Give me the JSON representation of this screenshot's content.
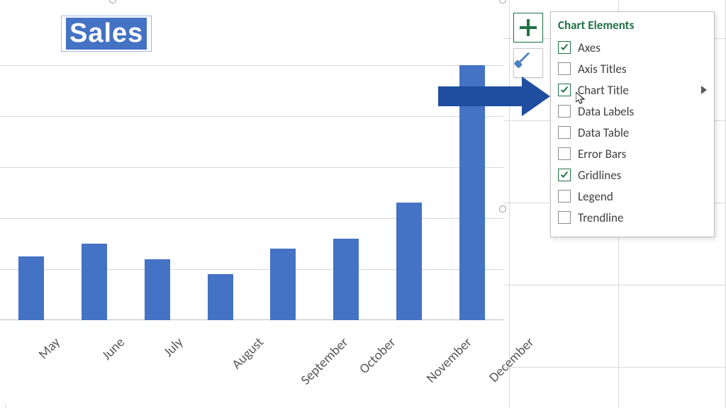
{
  "chart_title": "Sales",
  "flyout": {
    "title": "Chart Elements",
    "items": [
      {
        "label": "Axes",
        "checked": true,
        "submenu": false
      },
      {
        "label": "Axis Titles",
        "checked": false,
        "submenu": false
      },
      {
        "label": "Chart Title",
        "checked": true,
        "submenu": true
      },
      {
        "label": "Data Labels",
        "checked": false,
        "submenu": false
      },
      {
        "label": "Data Table",
        "checked": false,
        "submenu": false
      },
      {
        "label": "Error Bars",
        "checked": false,
        "submenu": false
      },
      {
        "label": "Gridlines",
        "checked": true,
        "submenu": false
      },
      {
        "label": "Legend",
        "checked": false,
        "submenu": false
      },
      {
        "label": "Trendline",
        "checked": false,
        "submenu": false
      }
    ]
  },
  "colors": {
    "bar": "#4472c4",
    "arrow": "#1f4ea1",
    "excel_green": "#217346"
  },
  "chart_data": {
    "type": "bar",
    "title": "Sales",
    "categories": [
      "May",
      "June",
      "July",
      "August",
      "September",
      "October",
      "November",
      "December"
    ],
    "values": [
      25,
      30,
      24,
      18,
      28,
      32,
      46,
      100
    ],
    "xlabel": "",
    "ylabel": "",
    "ylim": [
      0,
      100
    ],
    "gridlines": 5,
    "legend": false
  }
}
